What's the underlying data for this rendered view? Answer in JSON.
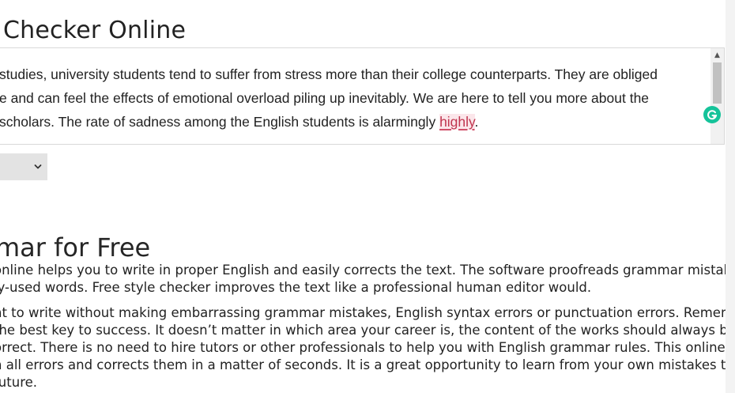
{
  "page": {
    "title": "Checker Online"
  },
  "editor": {
    "lines": [
      "studies, university students tend to suffer from stress more than their college counterparts. They are obliged",
      "e and can feel the effects of emotional overload piling up inevitably. We are here to tell you more about the",
      "scholars. The rate of sadness among the English students is alarmingly "
    ],
    "flagged_word": "highly",
    "trailing_punct": ".",
    "scroll_up_glyph": "▲"
  },
  "section": {
    "title": "mar for Free",
    "paragraph1": [
      "online helps you to write in proper English and easily corrects the text. The software proofreads grammar mistakes,",
      "ly-used words. Free style checker improves the text like a professional human editor would."
    ],
    "paragraph2": [
      "nt to write without making embarrassing grammar mistakes, English syntax errors or punctuation errors. Remember,",
      "the best key to success. It doesn’t matter in which area your career is, the content of the works should always be",
      "orrect. There is no need to hire tutors or other professionals to help you with English grammar rules. This online",
      "n all errors and corrects them in a matter of seconds. It is a great opportunity to learn from your own mistakes to",
      " future."
    ]
  },
  "colors": {
    "grammarly": "#15c39a",
    "flag_underline": "#d0506a"
  },
  "icons": {
    "assistant": "grammarly-icon",
    "dropdown": "chevron-down-icon"
  }
}
